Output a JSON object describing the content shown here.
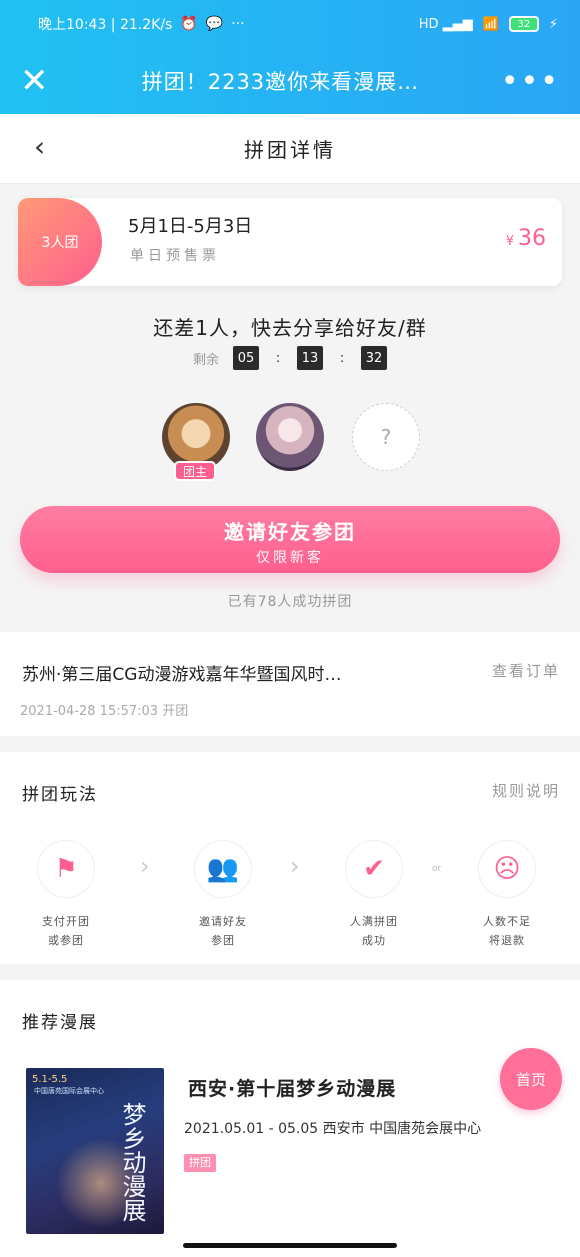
{
  "status": {
    "left": "晚上10:43 | 21.2K/s",
    "right_battery": "32"
  },
  "nav": {
    "close": "✕",
    "title": "拼团！2233邀你来看漫展…",
    "more": "•••"
  },
  "header": {
    "back": "‹",
    "title": "拼团详情"
  },
  "ticket": {
    "tag": "3人团",
    "date": "5月1日-5月3日",
    "type": "单日预售票",
    "currency": "¥",
    "price": "36"
  },
  "group": {
    "need": "还差1人，快去分享给好友/群",
    "remain_label": "剩余",
    "countdown": [
      "05",
      "13",
      "32"
    ],
    "owner_tag": "团主",
    "empty_slot": "?"
  },
  "invite": {
    "main": "邀请好友参团",
    "sub": "仅限新客",
    "joined": "已有78人成功拼团"
  },
  "order": {
    "name": "苏州·第三届CG动漫游戏嘉年华暨国风时…",
    "view": "查看订单",
    "time": "2021-04-28 15:57:03 开团"
  },
  "rules": {
    "title": "拼团玩法",
    "link": "规则说明",
    "or": "or",
    "steps": [
      {
        "label1": "支付开团",
        "label2": "或参团"
      },
      {
        "label1": "邀请好友",
        "label2": "参团"
      },
      {
        "label1": "人满拼团",
        "label2": "成功"
      },
      {
        "label1": "人数不足",
        "label2": "将退款"
      }
    ]
  },
  "recommend": {
    "title": "推荐漫展",
    "poster_dates": "5.1-5.5",
    "poster_venue": "中国唐苑国际会展中心",
    "poster_name": "梦乡动漫展",
    "event_title": "西安·第十届梦乡动漫展",
    "event_info": "2021.05.01 - 05.05  西安市  中国唐苑会展中心",
    "event_tag": "拼团"
  },
  "home_button": "首页"
}
